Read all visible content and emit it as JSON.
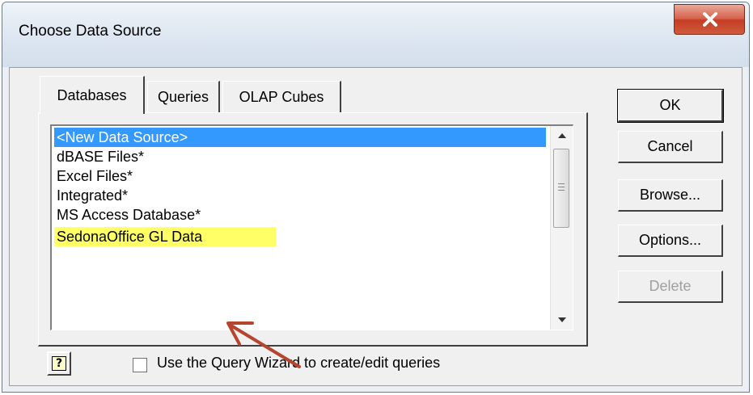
{
  "window": {
    "title": "Choose Data Source"
  },
  "tabs": [
    {
      "label": "Databases",
      "active": true
    },
    {
      "label": "Queries",
      "active": false
    },
    {
      "label": "OLAP Cubes",
      "active": false
    }
  ],
  "list": {
    "items": [
      {
        "label": "<New Data Source>",
        "state": "selected"
      },
      {
        "label": "dBASE Files*",
        "state": "normal"
      },
      {
        "label": "Excel Files*",
        "state": "normal"
      },
      {
        "label": "Integrated*",
        "state": "normal"
      },
      {
        "label": "MS Access Database*",
        "state": "normal"
      },
      {
        "label": "SedonaOffice GL Data",
        "state": "highlighted"
      }
    ]
  },
  "buttons": {
    "ok": "OK",
    "cancel": "Cancel",
    "browse": "Browse...",
    "options": "Options...",
    "delete": "Delete"
  },
  "checkbox": {
    "label": "Use the Query Wizard to create/edit queries",
    "checked": false
  },
  "icons": {
    "close": "close-icon",
    "help": "help-icon",
    "scroll_up": "scroll-up-arrow-icon",
    "scroll_down": "scroll-down-arrow-icon",
    "annotation": "annotation-arrow-icon"
  },
  "colors": {
    "selection": "#3399ff",
    "highlight": "#ffff66",
    "annotation_arrow": "#b5452e",
    "close_button": "#c94a33"
  }
}
